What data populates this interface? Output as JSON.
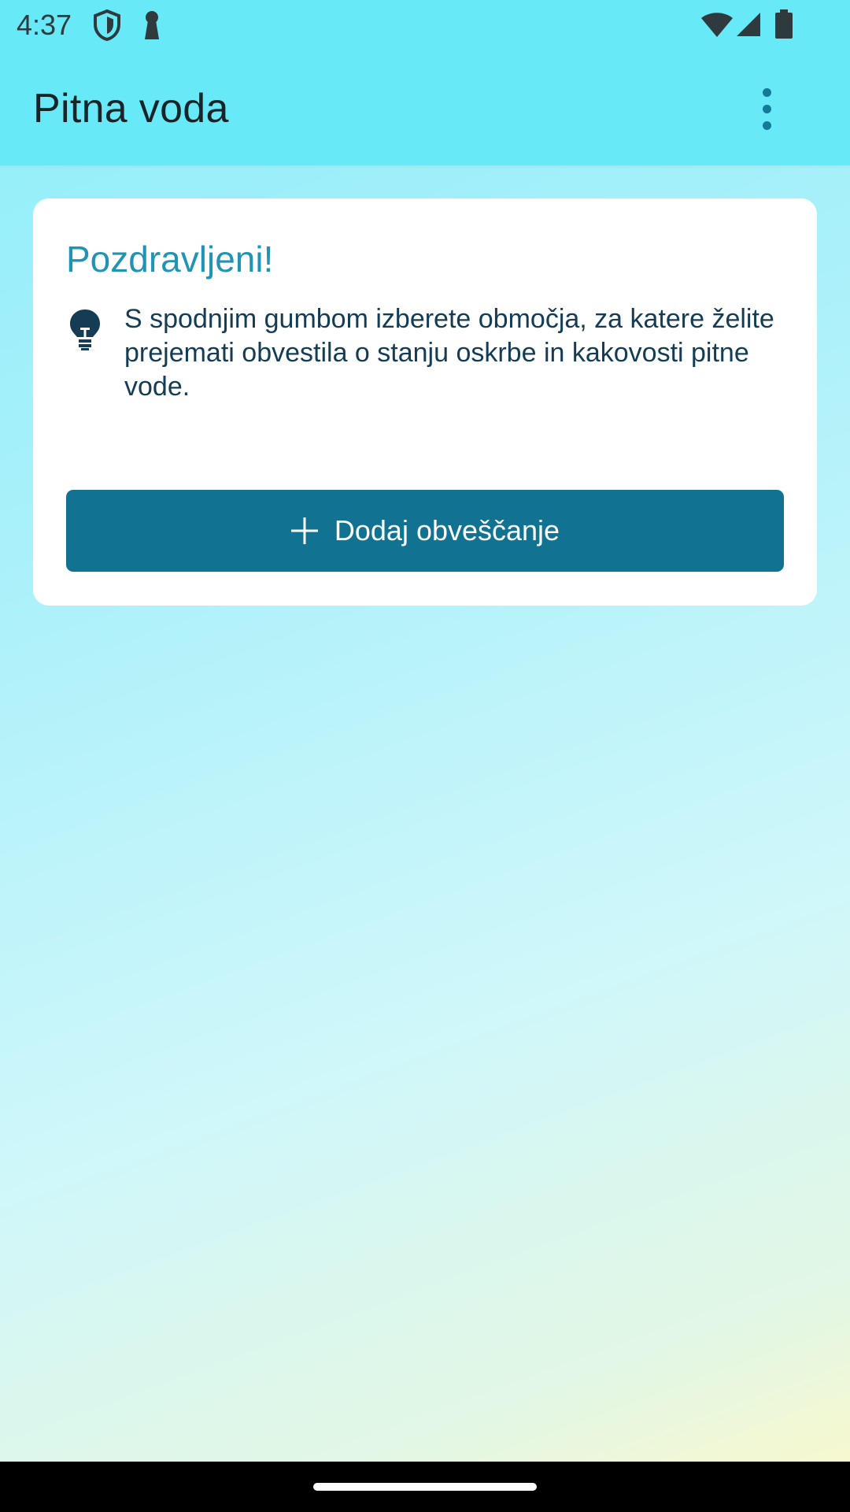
{
  "status_bar": {
    "time": "4:37",
    "left_icons": [
      "shield-icon",
      "keyhole-icon"
    ],
    "right_icons": [
      "wifi-icon",
      "cellular-signal-icon",
      "battery-icon"
    ]
  },
  "app_bar": {
    "title": "Pitna voda",
    "menu_icon": "more-vert-icon"
  },
  "card": {
    "title": "Pozdravljeni!",
    "tip_icon": "lightbulb-icon",
    "text": "S spodnjim gumbom izberete območja, za katere želite prejemati obvestila o stanju oskrbe in kakovosti pitne vode.",
    "button": {
      "icon": "plus-icon",
      "label": "Dodaj obveščanje"
    }
  },
  "colors": {
    "app_bar": "#68e9f7",
    "accent": "#117391",
    "title_accent": "#2193b4",
    "body_text": "#143c54"
  }
}
